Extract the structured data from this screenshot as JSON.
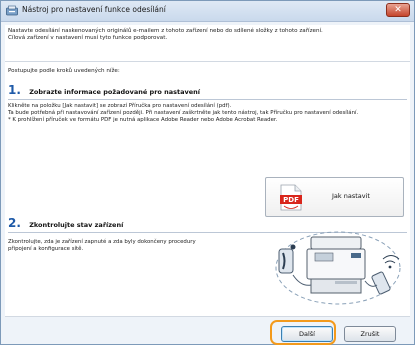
{
  "window": {
    "title": "Nástroj pro nastavení funkce odesílání",
    "close_label": "✕"
  },
  "intro": {
    "line1": "Nastavte odesílání naskenovaných originálů e-mailem z tohoto zařízení nebo do sdílené složky z tohoto zařízení.",
    "line2": "Cílová zařízení v nastavení musí tyto funkce podporovat."
  },
  "instructions": "Postupujte podle kroků uvedených níže:",
  "step1": {
    "number": "1.",
    "title": "Zobrazte informace požadované pro nastavení",
    "desc_line1": "Klikněte na položku [Jak nastavit] se zobrazí Příručka pro nastavení odesílání (pdf).",
    "desc_line2": "Ta bude potřebná při nastavování zařízení později. Při nastavení zaškrtněte jak tento nástroj, tak Příručku pro nastavení odesílání.",
    "desc_line3": "* K prohlížení příruček ve formátu PDF je nutná aplikace Adobe Reader nebo Adobe Acrobat Reader.",
    "howto_button": "Jak nastavit",
    "pdf_icon_text": "PDF"
  },
  "step2": {
    "number": "2.",
    "title": "Zkontrolujte stav zařízení",
    "desc_line1": "Zkontrolujte, zda je zařízení zapnuté a zda byly dokončeny procedury připojení a konfigurace sítě."
  },
  "buttons": {
    "next": "Další",
    "cancel": "Zrušit"
  },
  "colors": {
    "highlight": "#f39a1c",
    "step_number": "#1e5aa8",
    "pdf_red": "#d9261c"
  }
}
